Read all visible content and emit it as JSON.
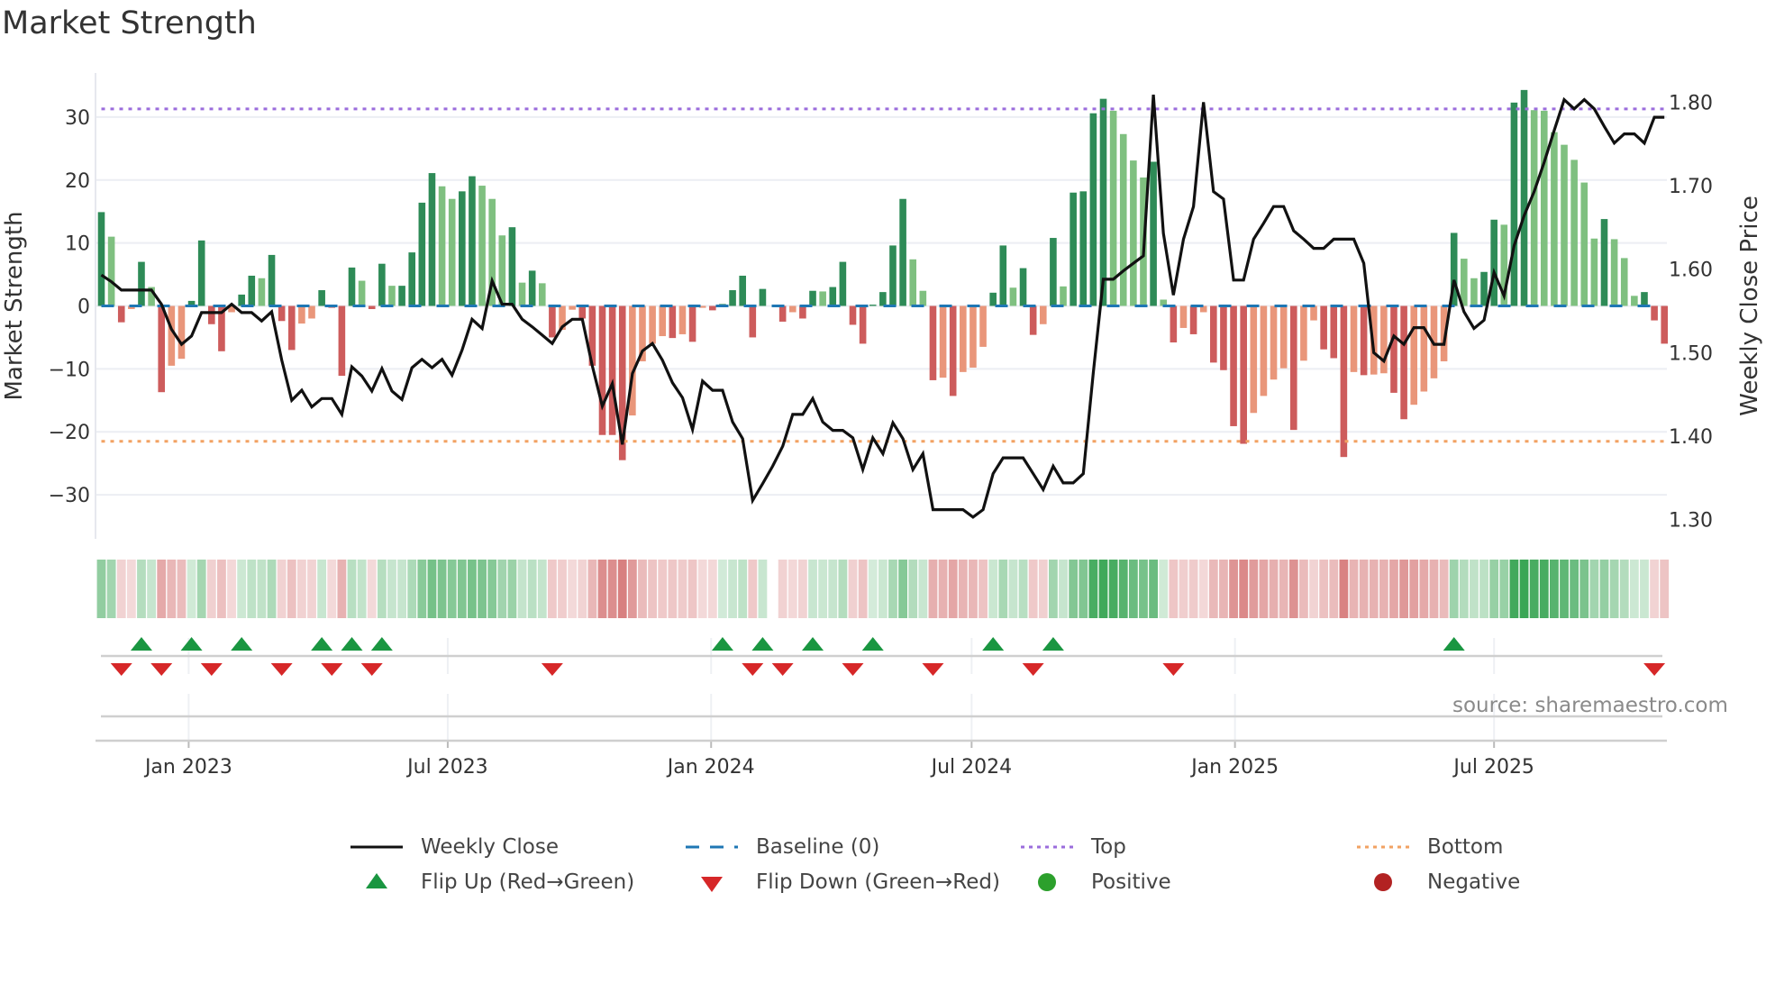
{
  "title": "Market Strength",
  "source": "source: sharemaestro.com",
  "legend": [
    {
      "label": "Weekly Close",
      "symbol": "line",
      "color": "#111111"
    },
    {
      "label": "Baseline (0)",
      "symbol": "dashed",
      "color": "#1f77b4"
    },
    {
      "label": "Top",
      "symbol": "dotted",
      "color": "#9b6ddc"
    },
    {
      "label": "Bottom",
      "symbol": "dotted",
      "color": "#f2a263"
    },
    {
      "label": "Flip Up (Red→Green)",
      "symbol": "triangle-up",
      "color": "#1a9641"
    },
    {
      "label": "Flip Down (Green→Red)",
      "symbol": "triangle-down",
      "color": "#d62728"
    },
    {
      "label": "Positive",
      "symbol": "circle",
      "color": "#2ca02c"
    },
    {
      "label": "Negative",
      "symbol": "circle",
      "color": "#b22222"
    }
  ],
  "colors": {
    "pos_strong": "#2e8b57",
    "pos_weak": "#7fc080",
    "neg_strong": "#cd5c5c",
    "neg_weak": "#e9967a",
    "heat_pos": "#3aa655",
    "heat_neg": "#cd5c5c",
    "baseline": "#1f77b4",
    "top": "#9b6ddc",
    "bottom": "#f2a263",
    "line": "#111111",
    "flip_up": "#1a9641",
    "flip_down": "#d62728"
  },
  "chart_data": {
    "type": "bar+line",
    "title": "Market Strength",
    "x_start_date": "2022-11-01",
    "x_step_days": 7,
    "x_ticks": [
      {
        "label": "Jan 2023",
        "date": "2023-01-01"
      },
      {
        "label": "Jul 2023",
        "date": "2023-07-01"
      },
      {
        "label": "Jan 2024",
        "date": "2024-01-01"
      },
      {
        "label": "Jul 2024",
        "date": "2024-07-01"
      },
      {
        "label": "Jan 2025",
        "date": "2025-01-01"
      },
      {
        "label": "Jul 2025",
        "date": "2025-07-01"
      }
    ],
    "y_left": {
      "label": "Market Strength",
      "lim": [
        -37,
        37
      ],
      "ticks": [
        -30,
        -20,
        -10,
        0,
        10,
        20,
        30
      ]
    },
    "y_right": {
      "label": "Weekly Close Price",
      "lim": [
        1.277,
        1.835
      ],
      "ticks": [
        1.3,
        1.4,
        1.5,
        1.6,
        1.7,
        1.8
      ]
    },
    "baseline": 0,
    "top": 31.3,
    "bottom": -21.5,
    "strength": [
      14.9,
      11,
      -2.6,
      -0.5,
      7,
      3,
      -13.7,
      -9.5,
      -8.4,
      0.8,
      10.4,
      -2.9,
      -7.2,
      -1,
      1.8,
      4.8,
      4.4,
      8.1,
      -2.4,
      -7,
      -2.8,
      -2,
      2.5,
      -0.3,
      -11.1,
      6.1,
      4,
      -0.5,
      6.7,
      3.2,
      3.2,
      8.5,
      16.4,
      21.1,
      19,
      17,
      18.2,
      20.6,
      19.1,
      17,
      11.2,
      12.5,
      3.7,
      5.6,
      3.6,
      -5,
      -3.8,
      -0.6,
      -2,
      -9.5,
      -20.5,
      -20.5,
      -24.5,
      -17.4,
      -8.8,
      -6,
      -4.8,
      -5.1,
      -4.5,
      -5.7,
      -0.3,
      -0.7,
      0.3,
      2.5,
      4.8,
      -5,
      2.7,
      0,
      -2.5,
      -1,
      -2,
      2.4,
      2.3,
      3,
      7,
      -3,
      -6,
      0.2,
      2.2,
      9.6,
      17,
      7.4,
      2.4,
      -11.8,
      -11.4,
      -14.3,
      -10.5,
      -9.8,
      -6.5,
      2.1,
      9.6,
      2.9,
      6,
      -4.6,
      -2.9,
      10.8,
      3.1,
      18,
      18.2,
      30.6,
      32.9,
      31,
      27.3,
      23.1,
      20.4,
      22.9,
      1,
      -5.8,
      -3.5,
      -4.5,
      -1,
      -9,
      -10.2,
      -19.1,
      -21.9,
      -17,
      -14.3,
      -11.7,
      -9.9,
      -19.7,
      -8.7,
      -2.3,
      -6.9,
      -8.3,
      -24,
      -10.5,
      -11,
      -10.9,
      -10.7,
      -13.8,
      -18,
      -15.7,
      -13.6,
      -11.5,
      -8.8,
      11.6,
      7.5,
      4.4,
      5.4,
      13.7,
      12.9,
      32.3,
      34.3,
      31.1,
      31,
      27.6,
      25.6,
      23.2,
      19.6,
      10.7,
      13.8,
      10.6,
      7.6,
      1.6,
      2.2,
      -2.3,
      -6
    ],
    "weekly_close": [
      1.593,
      1.585,
      1.575,
      1.575,
      1.575,
      1.575,
      1.558,
      1.528,
      1.51,
      1.52,
      1.548,
      1.548,
      1.548,
      1.558,
      1.548,
      1.548,
      1.538,
      1.549,
      1.491,
      1.443,
      1.455,
      1.435,
      1.445,
      1.445,
      1.426,
      1.483,
      1.472,
      1.454,
      1.481,
      1.454,
      1.444,
      1.482,
      1.492,
      1.482,
      1.492,
      1.473,
      1.503,
      1.54,
      1.529,
      1.586,
      1.558,
      1.558,
      1.54,
      1.531,
      1.521,
      1.511,
      1.531,
      1.54,
      1.54,
      1.484,
      1.436,
      1.463,
      1.39,
      1.475,
      1.502,
      1.511,
      1.491,
      1.464,
      1.446,
      1.408,
      1.466,
      1.455,
      1.455,
      1.417,
      1.397,
      1.323,
      1.343,
      1.364,
      1.388,
      1.426,
      1.426,
      1.445,
      1.417,
      1.407,
      1.407,
      1.398,
      1.36,
      1.398,
      1.379,
      1.416,
      1.397,
      1.36,
      1.379,
      1.312,
      1.312,
      1.312,
      1.312,
      1.303,
      1.312,
      1.355,
      1.374,
      1.374,
      1.374,
      1.355,
      1.336,
      1.364,
      1.344,
      1.344,
      1.355,
      1.476,
      1.588,
      1.588,
      1.598,
      1.607,
      1.616,
      1.809,
      1.643,
      1.569,
      1.636,
      1.675,
      1.8,
      1.693,
      1.684,
      1.587,
      1.587,
      1.636,
      1.655,
      1.675,
      1.675,
      1.646,
      1.636,
      1.625,
      1.625,
      1.636,
      1.636,
      1.636,
      1.607,
      1.5,
      1.49,
      1.52,
      1.51,
      1.53,
      1.53,
      1.51,
      1.51,
      1.587,
      1.549,
      1.529,
      1.539,
      1.596,
      1.568,
      1.628,
      1.664,
      1.693,
      1.728,
      1.766,
      1.803,
      1.792,
      1.803,
      1.792,
      1.771,
      1.751,
      1.762,
      1.762,
      1.751,
      1.782,
      1.782
    ],
    "flip_up_idx": [
      4,
      9,
      14,
      22,
      25,
      28,
      62,
      66,
      71,
      77,
      89,
      95,
      135
    ],
    "flip_down_idx": [
      2,
      6,
      11,
      18,
      23,
      27,
      45,
      65,
      68,
      75,
      83,
      93,
      107,
      155
    ]
  }
}
